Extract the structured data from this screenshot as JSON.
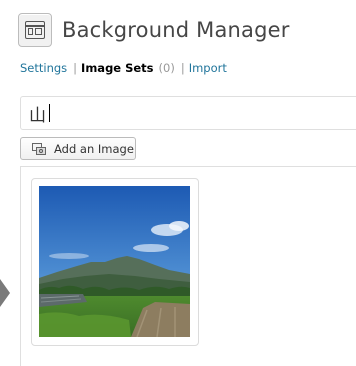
{
  "header": {
    "title": "Background Manager",
    "icon": "background-manager-icon"
  },
  "subnav": {
    "settings": "Settings",
    "separator_1": "|",
    "image_sets": "Image Sets",
    "image_sets_count": "(0)",
    "separator_2": "|",
    "import": "Import"
  },
  "form": {
    "set_name_value": "山"
  },
  "toolbar": {
    "add_image_label": "Add an Image",
    "add_image_icon": "add-media-icon"
  },
  "images": [
    {
      "thumbnail_icon": "landscape-thumbnail",
      "colors": {
        "sky_top": "#1f5fb8",
        "sky_bottom": "#7fb0e0",
        "mountain": "#4a6a4e",
        "grass": "#4f8a32",
        "path": "#8a7a5e"
      }
    }
  ],
  "colors": {
    "link": "#21759b",
    "current": "#000000",
    "count": "#999999",
    "border": "#dfdfdf"
  }
}
